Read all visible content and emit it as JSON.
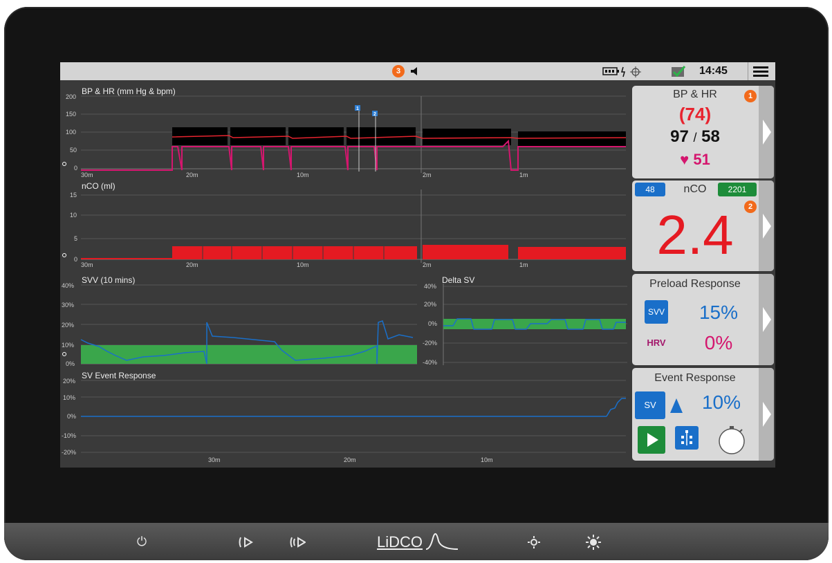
{
  "statusbar": {
    "alert_count": "3",
    "time": "14:45"
  },
  "charts": {
    "bp_hr": {
      "title": "BP & HR (mm Hg & bpm)",
      "yticks": [
        "200",
        "150",
        "100",
        "50",
        "0"
      ],
      "xticks": [
        "30m",
        "20m",
        "10m",
        "2m",
        "1m"
      ],
      "markers": [
        "1",
        "2"
      ]
    },
    "nco": {
      "title": "nCO (ml)",
      "yticks": [
        "15",
        "10",
        "5",
        "0"
      ],
      "xticks": [
        "30m",
        "20m",
        "10m",
        "2m",
        "1m"
      ]
    },
    "svv": {
      "title": "SVV (10 mins)",
      "yticks": [
        "40%",
        "30%",
        "20%",
        "10%",
        "0%"
      ]
    },
    "delta_sv": {
      "title": "Delta SV",
      "yticks": [
        "40%",
        "20%",
        "0%",
        "-20%",
        "-40%"
      ]
    },
    "sv_event": {
      "title": "SV Event Response",
      "yticks": [
        "20%",
        "10%",
        "0%",
        "-10%",
        "-20%"
      ],
      "xticks": [
        "30m",
        "20m",
        "10m"
      ]
    }
  },
  "panels": {
    "bp_hr": {
      "title": "BP & HR",
      "badge": "1",
      "mean": "(74)",
      "systolic": "97",
      "separator": "/",
      "diastolic": "58",
      "heart_rate": "51"
    },
    "nco": {
      "left_tag": "48",
      "title": "nCO",
      "right_tag": "2201",
      "badge": "2",
      "value": "2.4"
    },
    "preload": {
      "title": "Preload Response",
      "svv_label": "SVV",
      "svv_value": "15%",
      "hrv_label": "HRV",
      "hrv_value": "0%"
    },
    "event": {
      "title": "Event Response",
      "sv_label": "SV",
      "value": "10%"
    }
  },
  "device": {
    "brand": "LiDCO"
  },
  "colors": {
    "bp_red": "#e8242f",
    "hr_magenta": "#d4166e",
    "nco_red": "#e51a22",
    "svv_blue": "#1a6fc9",
    "green_band": "#3aa64b",
    "alert_orange": "#f26a1b",
    "play_green": "#1d8c3a"
  },
  "chart_data": [
    {
      "type": "line",
      "title": "BP & HR (mm Hg & bpm)",
      "ylim": [
        0,
        200
      ],
      "series": [
        {
          "name": "",
          "values": []
        }
      ]
    },
    {
      "type": "bar",
      "title": "nCO (ml)",
      "ylim": [
        0,
        15
      ]
    },
    {
      "type": "line",
      "title": "SVV (10 mins)",
      "ylim": [
        0,
        40
      ]
    },
    {
      "type": "line",
      "title": "Delta SV",
      "ylim": [
        -40,
        40
      ]
    },
    {
      "type": "line",
      "title": "SV Event Response",
      "ylim": [
        -20,
        20
      ]
    }
  ]
}
